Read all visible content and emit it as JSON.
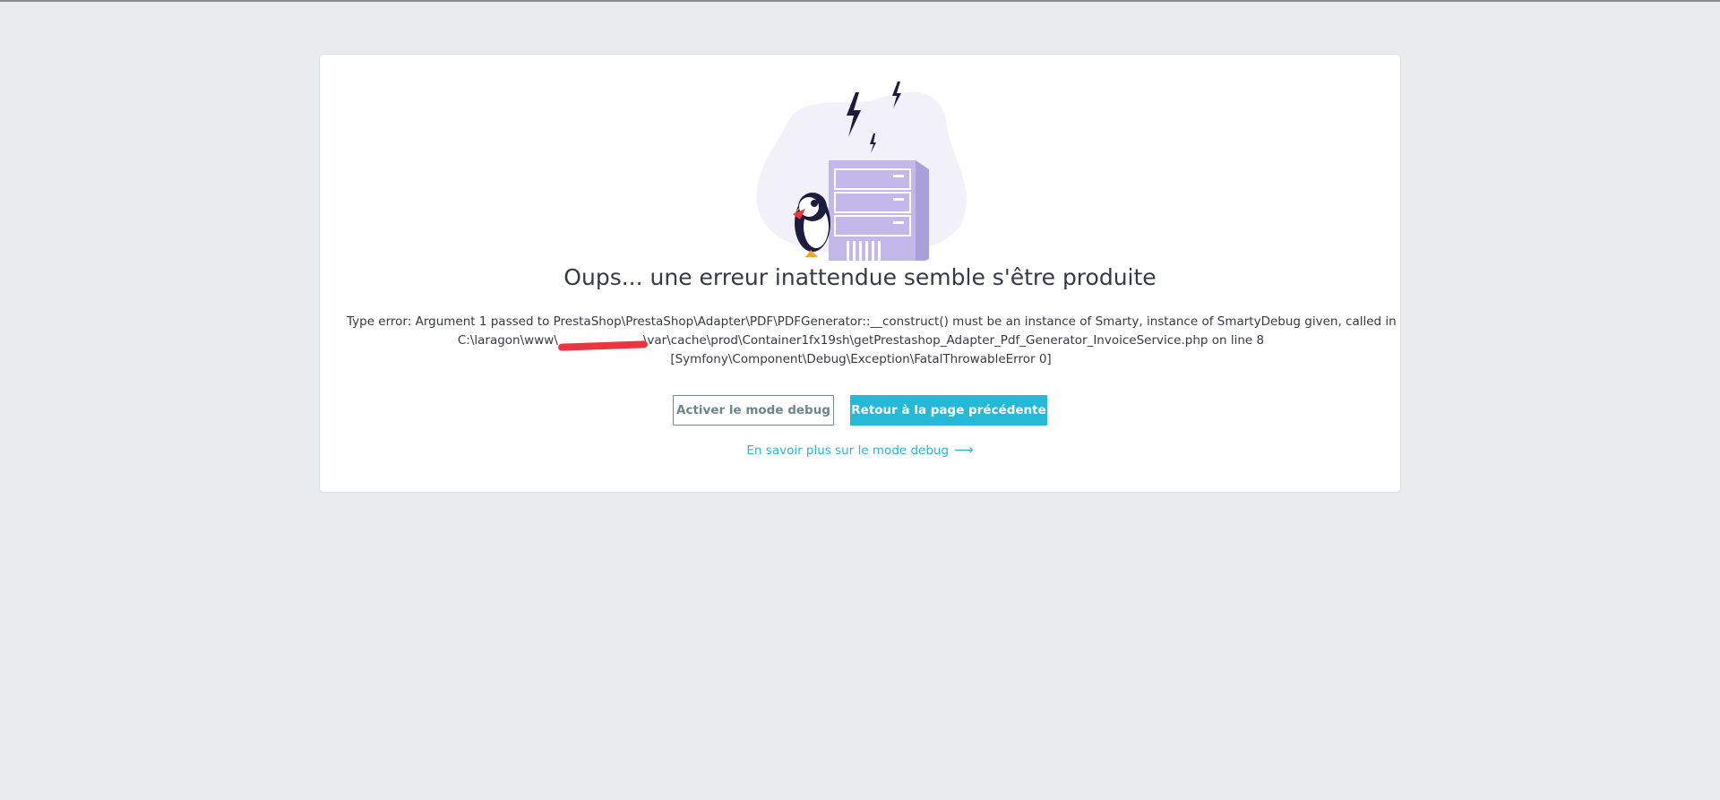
{
  "page": {
    "title": "Oups... une erreur inattendue semble s'être produite",
    "error_line1": "Type error: Argument 1 passed to PrestaShop\\PrestaShop\\Adapter\\PDF\\PDFGenerator::__construct() must be an instance of Smarty, instance of SmartyDebug given, called in",
    "error_path_start": "C:\\laragon\\www\\",
    "error_path_end": "\\var\\cache\\prod\\Container1fx19sh\\getPrestashop_Adapter_Pdf_Generator_InvoiceService.php on line 8",
    "error_line3": "[Symfony\\Component\\Debug\\Exception\\FatalThrowableError 0]"
  },
  "buttons": {
    "debug_label": "Activer le mode debug",
    "back_label": "Retour à la page précédente"
  },
  "link": {
    "learn_more": "En savoir plus sur le mode debug",
    "arrow": "⟶"
  },
  "icons": {
    "illustration": "server-error-puffin-illustration"
  },
  "colors": {
    "accent": "#25b9d7",
    "secondary": "#6c868e",
    "text": "#363a41",
    "background": "#eaebed",
    "redaction": "#ef3340"
  }
}
